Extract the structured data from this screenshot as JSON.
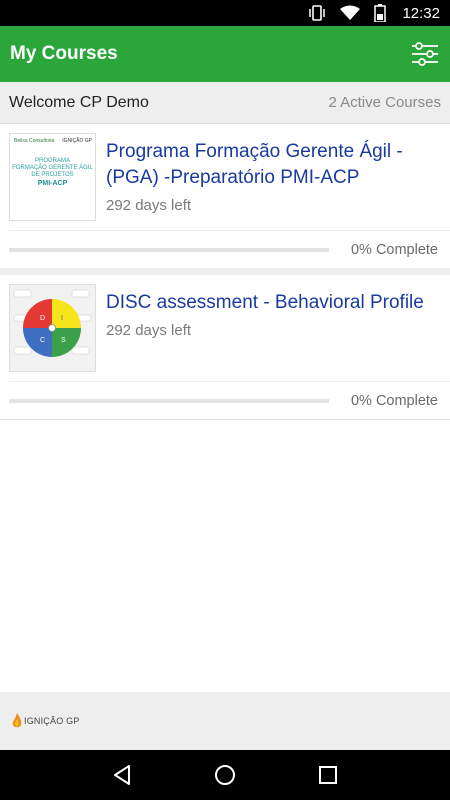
{
  "status_bar": {
    "time": "12:32",
    "icons": [
      "vibrate-icon",
      "wifi-icon",
      "battery-icon"
    ]
  },
  "app_bar": {
    "title": "My Courses",
    "filter_icon": "filter-sliders-icon",
    "color": "#2aa63a"
  },
  "welcome": {
    "greeting": "Welcome CP Demo",
    "active_count": "2 Active Courses"
  },
  "courses": [
    {
      "title": "Programa Formação Gerente Ágil - (PGA) -Preparatório PMI-ACP",
      "days_left": "292 days left",
      "progress": 0,
      "progress_label": "0% Complete",
      "thumb": {
        "logo_left": "Belisa Consultoria",
        "logo_right": "IGNIÇÃO GP",
        "line1": "PROGRAMA",
        "line2": "FORMAÇÃO GERENTE ÁGIL",
        "line3": "DE PROJETOS",
        "line4": "PMI-ACP"
      }
    },
    {
      "title": "DISC assessment - Behavioral Profile",
      "days_left": "292 days left",
      "progress": 0,
      "progress_label": "0% Complete",
      "thumb": {
        "q1": "D",
        "q2": "I",
        "q3": "C",
        "q4": "S",
        "colors": [
          "#e53935",
          "#f6e51b",
          "#3f6fc2",
          "#3aa04a"
        ]
      }
    }
  ],
  "footer": {
    "brand": "IGNIÇÃO GP"
  },
  "nav_bar": {
    "icons": [
      "back-icon",
      "home-icon",
      "recents-icon"
    ]
  }
}
